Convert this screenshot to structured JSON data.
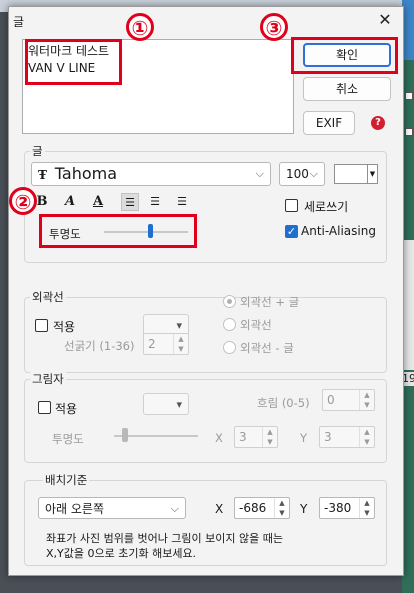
{
  "dialog": {
    "title": "글",
    "text_content": "워터마크 테스트\nVAN V LINE",
    "buttons": {
      "ok": "확인",
      "cancel": "취소",
      "exif": "EXIF"
    },
    "help_icon": "?"
  },
  "annotations": {
    "badge1": "①",
    "badge2": "②",
    "badge3": "③"
  },
  "font_group": {
    "label": "글",
    "font_icon": "Ŧ",
    "font_name": "Tahoma",
    "font_size": "100",
    "format_buttons": {
      "bold": "B",
      "italic": "A",
      "underline": "A"
    },
    "alignment_active": "left",
    "vertical_label": "세로쓰기",
    "vertical_checked": false,
    "antialias_label": "Anti-Aliasing",
    "antialias_checked": true,
    "opacity_label": "투명도",
    "opacity_fraction": 0.55,
    "text_color": "#ffffff"
  },
  "outline_group": {
    "label": "외곽선",
    "apply_label": "적용",
    "thickness_label": "선굵기 (1-36)",
    "thickness_value": "2",
    "options": [
      "외곽선 + 글",
      "외곽선",
      "외곽선 - 글"
    ],
    "selected_option": 0
  },
  "shadow_group": {
    "label": "그림자",
    "apply_label": "적용",
    "blur_label": "흐림 (0-5)",
    "blur_value": "0",
    "opacity_label": "투명도",
    "opacity_fraction": 0.12,
    "x_label": "X",
    "x_value": "3",
    "y_label": "Y",
    "y_value": "3"
  },
  "position_group": {
    "label": "배치기준",
    "anchor": "아래 오른쪽",
    "x_label": "X",
    "x_value": "-686",
    "y_label": "Y",
    "y_value": "-380",
    "hint_line1": "좌표가 사진 범위를 벗어나 그림이 보이지 않을 때는",
    "hint_line2": "X,Y값을 0으로 초기화 해보세요."
  },
  "background": {
    "side_number": "19"
  },
  "colors": {
    "annotation_red": "#e0001b",
    "accent_blue": "#1f6fd1"
  }
}
